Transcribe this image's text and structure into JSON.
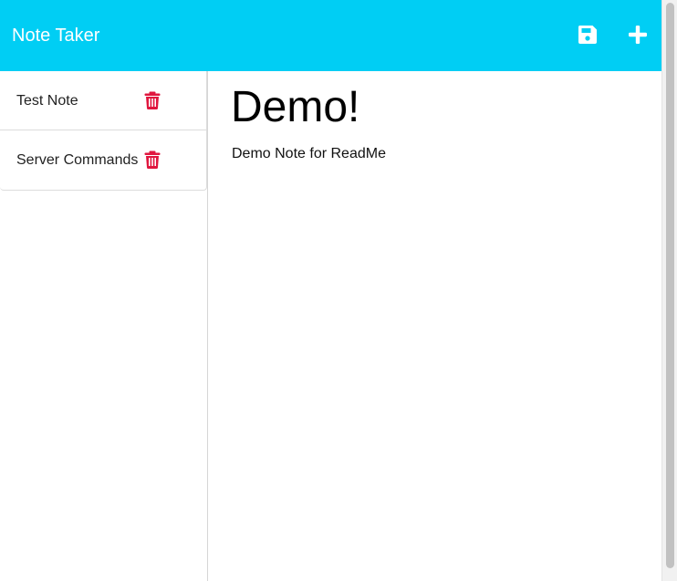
{
  "navbar": {
    "brand": "Note Taker",
    "save_icon": "save-icon",
    "new_icon": "plus-icon",
    "bg_color": "#00CEF4"
  },
  "sidebar": {
    "notes": [
      {
        "title": "Test Note",
        "delete_icon": "trash-icon"
      },
      {
        "title": "Server Commands",
        "delete_icon": "trash-icon"
      }
    ],
    "delete_color": "#E0163E"
  },
  "main": {
    "title": "Demo!",
    "body": "Demo Note for ReadMe"
  }
}
